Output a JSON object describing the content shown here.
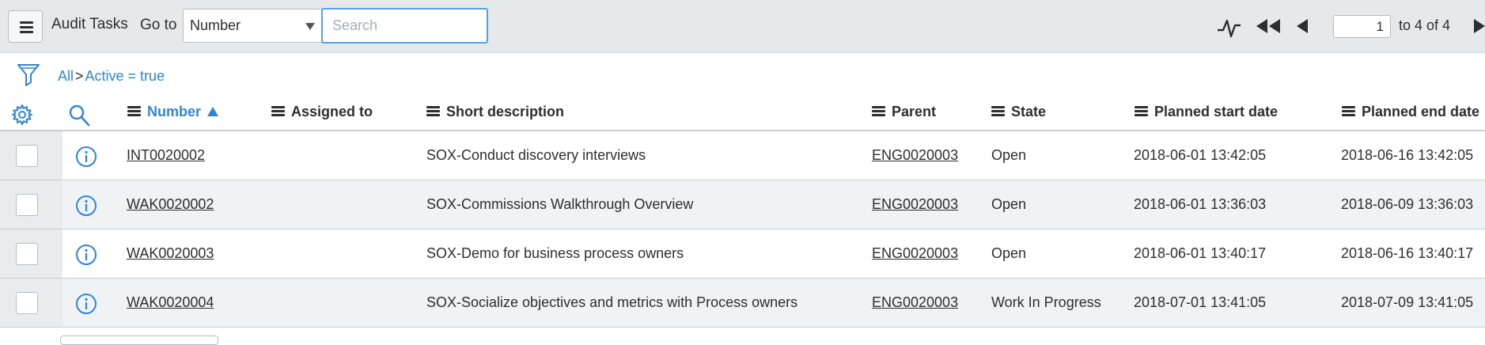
{
  "header": {
    "title": "Audit Tasks",
    "goto_label": "Go to",
    "goto_selected": "Number",
    "search_placeholder": "Search",
    "page_number": "1",
    "range_text": "to 4 of 4"
  },
  "breadcrumb": {
    "all": "All",
    "separator": ">",
    "filter": "Active = true"
  },
  "columns": {
    "number": "Number",
    "assigned_to": "Assigned to",
    "short_description": "Short description",
    "parent": "Parent",
    "state": "State",
    "planned_start": "Planned start date",
    "planned_end": "Planned end date"
  },
  "sort": {
    "column": "Number",
    "direction": "ascending"
  },
  "rows": [
    {
      "number": "INT0020002",
      "assigned_to": "",
      "short_description": "SOX-Conduct discovery interviews",
      "parent": "ENG0020003",
      "state": "Open",
      "planned_start": "2018-06-01 13:42:05",
      "planned_end": "2018-06-16 13:42:05"
    },
    {
      "number": "WAK0020002",
      "assigned_to": "",
      "short_description": "SOX-Commissions Walkthrough Overview",
      "parent": "ENG0020003",
      "state": "Open",
      "planned_start": "2018-06-01 13:36:03",
      "planned_end": "2018-06-09 13:36:03"
    },
    {
      "number": "WAK0020003",
      "assigned_to": "",
      "short_description": "SOX-Demo for business process owners",
      "parent": "ENG0020003",
      "state": "Open",
      "planned_start": "2018-06-01 13:40:17",
      "planned_end": "2018-06-16 13:40:17"
    },
    {
      "number": "WAK0020004",
      "assigned_to": "",
      "short_description": "SOX-Socialize objectives and metrics with Process owners",
      "parent": "ENG0020003",
      "state": "Work In Progress",
      "planned_start": "2018-07-01 13:41:05",
      "planned_end": "2018-07-09 13:41:05"
    }
  ],
  "icons": {
    "menu": "hamburger-menu-icon",
    "activity": "activity-stream-icon",
    "first_page": "first-page-icon",
    "prev_page": "previous-page-icon",
    "next_page": "next-page-icon",
    "filter": "filter-funnel-icon",
    "personalize": "gear-icon",
    "column_search": "search-icon",
    "row_info": "info-icon"
  },
  "colors": {
    "accent": "#2f86d9",
    "header_bg": "#e6e8ea",
    "row_alt_bg": "#f1f2f3",
    "search_focus": "#5aa0e6"
  }
}
